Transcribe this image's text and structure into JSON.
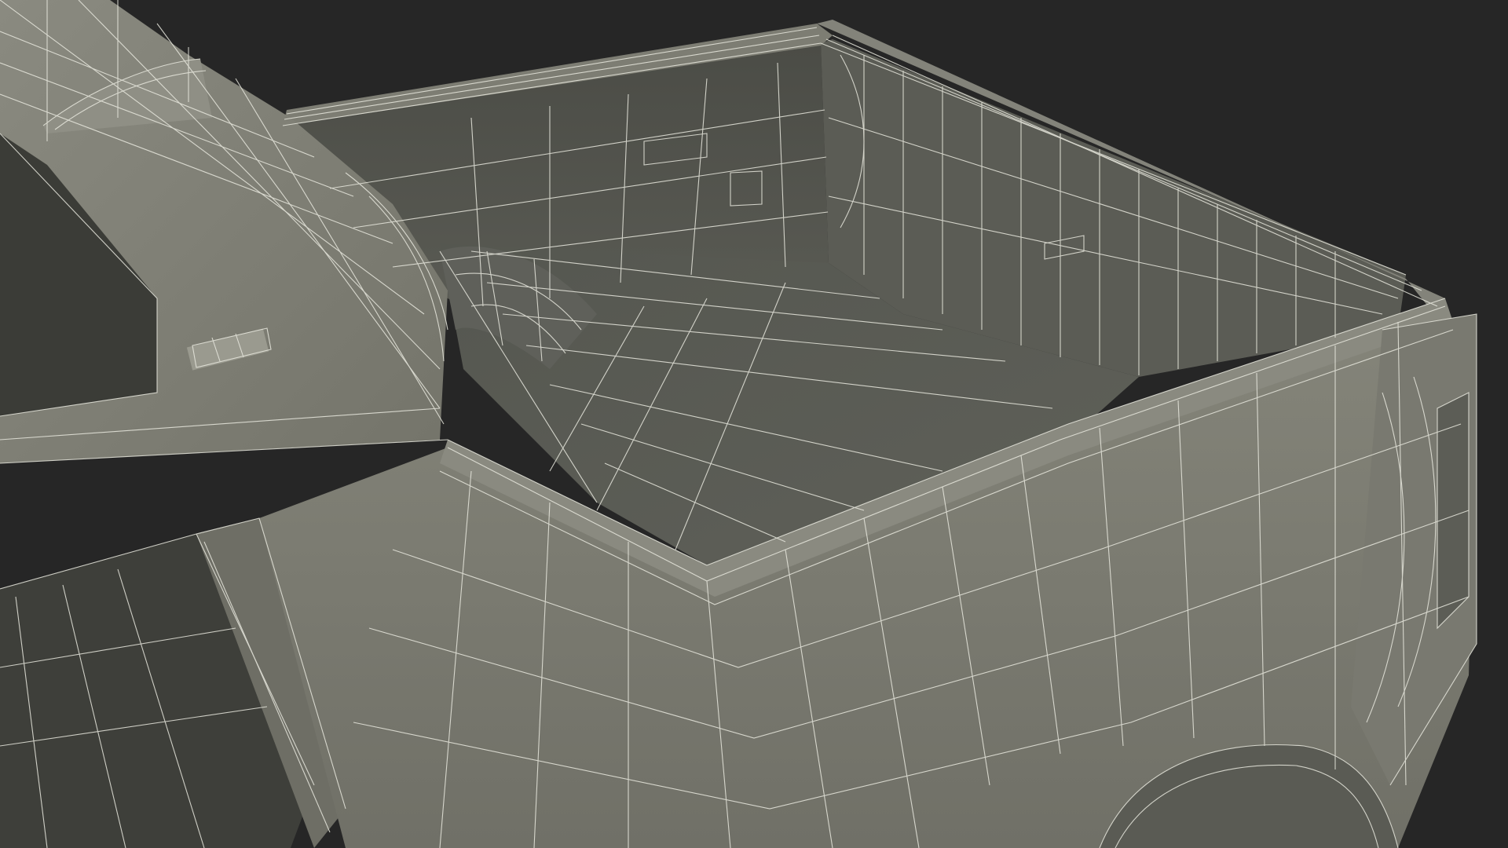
{
  "scene": {
    "subject": "pickup-truck-bed-wireframe",
    "colors": {
      "background": "#262626",
      "body_light": "#7b7b70",
      "body_mid": "#6c6c62",
      "body_dark": "#4a4b44",
      "bed_floor": "#545650",
      "wire": "#e9e9df",
      "glass": "#3a3b37"
    }
  }
}
